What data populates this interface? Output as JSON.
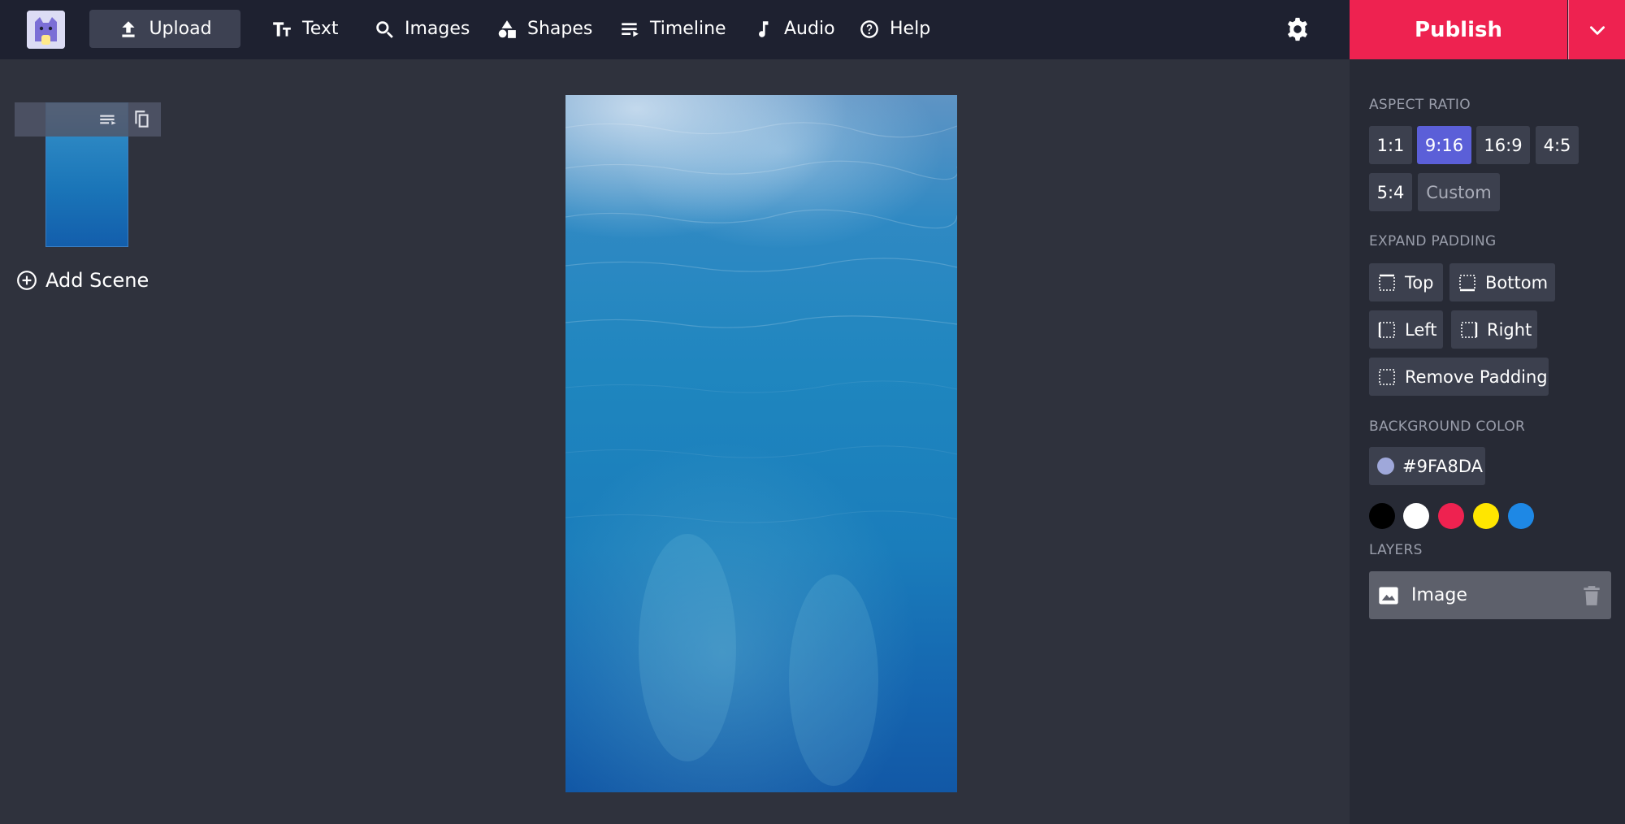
{
  "topbar": {
    "upload_label": "Upload",
    "nav": [
      {
        "label": "Text",
        "icon": "text-size-icon"
      },
      {
        "label": "Images",
        "icon": "search-icon"
      },
      {
        "label": "Shapes",
        "icon": "shapes-icon"
      },
      {
        "label": "Timeline",
        "icon": "timeline-icon"
      },
      {
        "label": "Audio",
        "icon": "music-note-icon"
      },
      {
        "label": "Help",
        "icon": "help-circle-icon"
      }
    ],
    "publish_label": "Publish",
    "icons": {
      "logo": "cat-logo-icon",
      "settings": "gear-icon",
      "dropdown": "chevron-down-icon"
    }
  },
  "scenes": {
    "add_scene_label": "Add Scene",
    "icons": {
      "reorder": "reorder-icon",
      "duplicate": "duplicate-icon",
      "add": "plus-circle-icon"
    }
  },
  "panel": {
    "aspect_ratio": {
      "label": "ASPECT RATIO",
      "options": [
        "1:1",
        "9:16",
        "16:9",
        "4:5",
        "5:4",
        "Custom"
      ],
      "selected": "9:16"
    },
    "expand_padding": {
      "label": "EXPAND PADDING",
      "top": "Top",
      "bottom": "Bottom",
      "left": "Left",
      "right": "Right",
      "remove": "Remove Padding"
    },
    "background_color": {
      "label": "BACKGROUND COLOR",
      "value": "#9FA8DA",
      "swatches": [
        "#000000",
        "#ffffff",
        "#ee2250",
        "#ffe600",
        "#1e88e5"
      ]
    },
    "layers": {
      "label": "LAYERS",
      "items": [
        {
          "name": "Image",
          "icon": "image-icon"
        }
      ],
      "icons": {
        "delete": "trash-icon"
      }
    }
  },
  "colors": {
    "accent": "#ee2250",
    "selected": "#5b5fd8",
    "topbar_bg": "#1e2130",
    "workspace_bg": "#2f323d",
    "panel_bg": "#272a35"
  }
}
